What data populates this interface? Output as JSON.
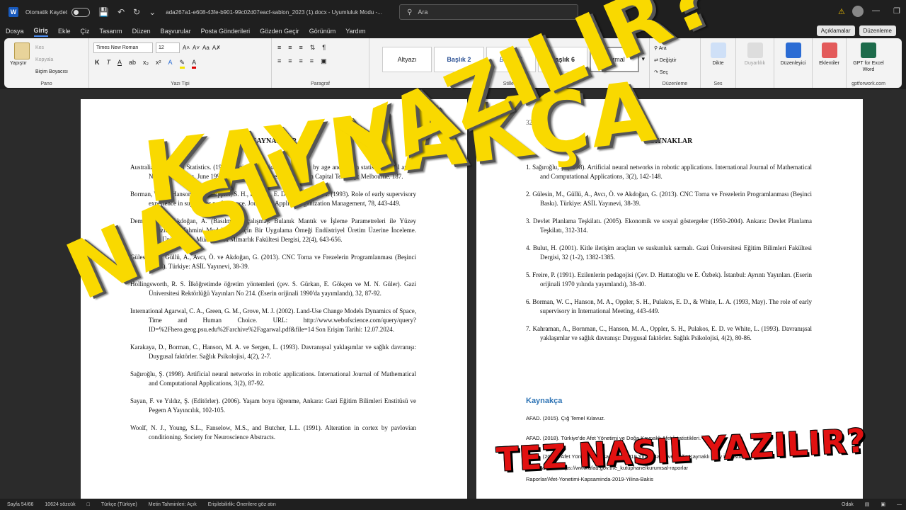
{
  "titlebar": {
    "autosave_label": "Otomatik Kaydet",
    "doc_title": "ada267a1-e608-43fe-b901-99c02d07eacf-sablon_2023 (1).docx  -  Uyumluluk Modu  -...",
    "search_placeholder": "Ara"
  },
  "menu": {
    "tabs": [
      "Dosya",
      "Giriş",
      "Ekle",
      "Çiz",
      "Tasarım",
      "Düzen",
      "Başvurular",
      "Posta Gönderileri",
      "Gözden Geçir",
      "Görünüm",
      "Yardım"
    ],
    "comments": "Açıklamalar",
    "editing": "Düzenleme"
  },
  "ribbon": {
    "paste": "Yapıştır",
    "cut": "Kes",
    "copy": "Kopyala",
    "format_painter": "Biçim Boyacısı",
    "pano": "Pano",
    "font_name": "Times New Roman",
    "font_size": "12",
    "font_group": "Yazı Tipi",
    "paragraph_group": "Paragraf",
    "styles": [
      "Altyazı",
      "Başlık 2",
      "Başlık 4",
      "Başlık 6",
      "Normal"
    ],
    "styles_group": "Stiller",
    "find": "Ara",
    "replace": "Değiştir",
    "select": "Seç",
    "edit_group": "Düzenleme",
    "dictate": "Dikte",
    "voice_group": "Ses",
    "sensitivity": "Duyarlılık",
    "editor": "Düzenleyici",
    "addins": "Eklentiler",
    "gpt": "GPT for Excel Word",
    "gpt_group": "gptforwork.com"
  },
  "left_page": {
    "page_number": "31",
    "heading": "KAYNAKLAR",
    "refs": [
      "Australian Bureau of Statistics. (1991). Estimated resident population by age and sex in statistical local areas. New South Wales, June 1990 (No. 3209.1). Canberra, Australian Capital Territory: Melbourne. 187.",
      "Borman, W. C., Hanson, M. A., Oppler, S. H., Pulakos, E. D., & White, L. A. (1993). Role of early supervisory experience in supervisor performance. Journal of Applied Organization Management, 78, 443-449.",
      "Demir, M. ve Akdoğan, A. (Basılmamış çalışma). Bulanık Mantık ve İşleme Parametreleri ile Yüzey Pürüzlülüğü Tahmini Modellemesi için Bir Uygulama Örneği Endüstriyel Üretim Üzerine İnceleme. Gazi Üniversitesi, Mühendislik Mimarlık Fakültesi Dergisi, 22(4), 643-656.",
      "Gülesin, M., Güllü, A., Avcı, Ö. ve Akdoğan, G. (2013). CNC Torna ve Frezelerin Programlanması (Beşinci Baskı). Türkiye: ASİL Yayınevi, 38-39.",
      "Hollingsworth, R. S. İlköğretimde öğretim yöntemleri (çev. S. Gürkan, E. Gökçen ve M. N. Güler). Gazi Üniversitesi Rektörlüğü Yayınları No 214. (Eserin orijinali 1990'da yayımlandı), 32, 87-92.",
      "International Agarwal, C. A., Green, G. M., Grove, M. J. (2002). Land-Use Change Models Dynamics of Space, Time and Human Choice. URL: http://www.webofscience.com/query/query?ID=%2Fhero.geog.psu.edu%2Farchive%2Fagarwal.pdf&file=14 Son Erişim Tarihi: 12.07.2024.",
      "Karakaya, D., Borman, C., Hanson, M. A. ve Sergen, L. (1993). Davranışsal yaklaşımlar ve sağlık davranışı: Duygusal faktörler. Sağlık Psikolojisi, 4(2), 2-7.",
      "Sağıroğlu, Ş. (1998). Artificial neural networks in robotic applications. International Journal of Mathematical and Computational Applications, 3(2), 87-92.",
      "Sayan, F. ve Yıldız, Ş. (Editörler). (2006). Yaşam boyu öğrenme, Ankara: Gazi Eğitim Bilimleri Enstitüsü ve Pegem A Yayıncılık, 102-105.",
      "Woolf, N. J., Young, S.L., Fanselow, M.S., and Butcher, L.L. (1991). Alteration in cortex by pavlovian conditioning. Society for Neuroscience Abstracts."
    ]
  },
  "right_page": {
    "page_number": "32",
    "heading": "KAYNAKLAR",
    "refs": [
      "1. Sağıroğlu, Ş. (1998). Artificial neural networks in robotic applications. International Journal of Mathematical and Computational Applications, 3(2), 142-148.",
      "2. Gülesin, M., Güllü, A., Avcı, Ö. ve Akdoğan, G. (2013). CNC Torna ve Frezelerin Programlanması (Beşinci Baskı). Türkiye: ASİL Yayınevi, 38-39.",
      "3. Devlet Planlama Teşkilatı. (2005). Ekonomik ve sosyal göstergeler (1950-2004). Ankara: Devlet Planlama Teşkilatı, 312-314.",
      "4. Bulut, H. (2001). Kitle iletişim araçları ve suskunluk sarmalı. Gazi Üniversitesi Eğitim Bilimleri Fakültesi Dergisi, 32 (1-2), 1382-1385.",
      "5. Freire, P. (1991). Ezilenlerin pedagojisi (Çev. D. Hattatoğlu ve E. Özbek). İstanbul: Ayrıntı Yayınları. (Eserin orijinali 1970 yılında yayımlandı), 38-40.",
      "6. Borman, W. C., Hanson, M. A., Oppler, S. H., Pulakos, E. D., & White, L. A. (1993, May). The role of early supervisory in International Meeting, 443-449.",
      "7. Kahraman, A., Bornman, C., Hanson, M. A., Oppler, S. H., Pulakos, E. D. ve White, L. (1993). Davranışsal yaklaşımlar ve sağlık davranışı: Duygusal faktörler. Sağlık Psikolojisi, 4(2), 80-86."
    ],
    "apa_heading": "Kaynakça",
    "apa_refs": [
      "AFAD. (2015). Çığ Temel Kılavuz.",
      "AFAD. (2018). Türkiye'de Afet Yönetimi ve Doğa Kaynaklı Afet İstatistikleri.",
      "AFAD. (2020). Afet Yönetimi Kapsamında 2019 Yılına Bakış ve Doğa Kaynaklı Olay İstatistikleri.",
      "Erişim adresi: https://www.afad.gov.tr/e_kutuphane/kurumsal-raporlar",
      "Raporlar/Afet-Yonetimi-Kapsaminda-2019-Yilina-Bakis"
    ]
  },
  "overlay": {
    "line1": "KAYNAKÇA",
    "line2": "NASIL YAZILIR?",
    "line3": "TEZ NASIL YAZILIR?"
  },
  "statusbar": {
    "page": "Sayfa 54/66",
    "words": "10624 sözcük",
    "lang": "Türkçe (Türkiye)",
    "predict": "Metin Tahminleri: Açık",
    "access": "Erişilebilirlik: Önerilere göz atın",
    "focus": "Odak"
  },
  "colors": {
    "overlay_yellow": "#f9d900",
    "overlay_red": "#e11111",
    "heading_blue": "#2e74b5"
  }
}
